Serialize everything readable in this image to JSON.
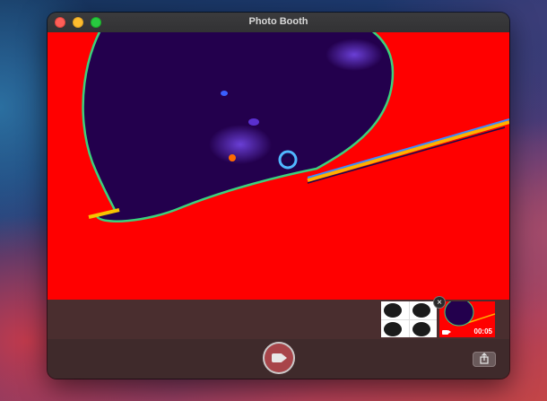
{
  "window": {
    "title": "Photo Booth"
  },
  "preview": {
    "effect": "thermal camera",
    "background_color": "#ff0000"
  },
  "thumbnails": [
    {
      "kind": "photo-grid",
      "count": 4
    },
    {
      "kind": "video",
      "duration": "00:05",
      "selected": true
    }
  ],
  "thumbnail_close_glyph": "×",
  "controls": {
    "record_icon": "video-camera-icon",
    "share_icon": "share-icon"
  },
  "colors": {
    "close": "#ff5f57",
    "minimize": "#febc2e",
    "maximize": "#28c840",
    "record_button": "#a8454a"
  }
}
